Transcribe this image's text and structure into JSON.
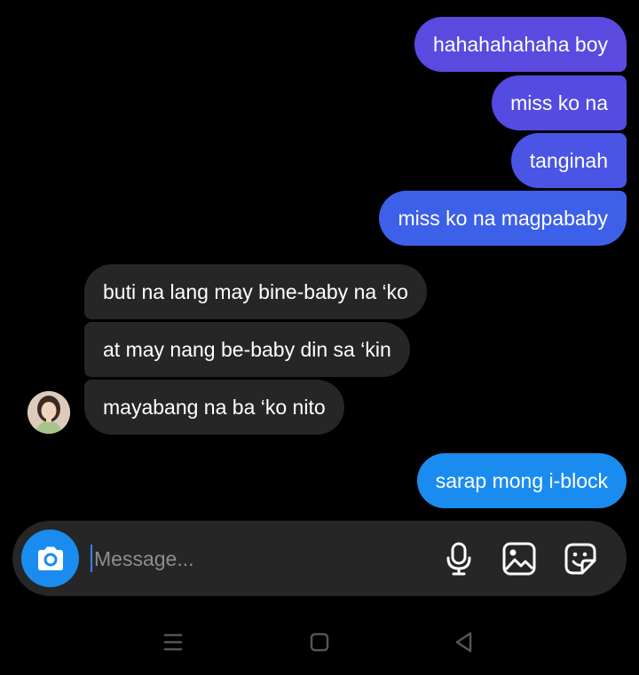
{
  "thread": {
    "sent_top": [
      "hahahahahaha boy",
      "miss ko na",
      "tanginah",
      "miss ko na magpababy"
    ],
    "received": [
      "buti na lang may bine-baby na ‘ko",
      "at may nang be-baby din sa ‘kin",
      "mayabang na ba ‘ko nito"
    ],
    "sent_bottom": [
      "sarap mong i-block"
    ]
  },
  "composer": {
    "placeholder": "Message..."
  },
  "colors": {
    "background": "#000000",
    "received_bubble": "#262626",
    "sent_gradient": [
      "#5b4ae0",
      "#1a8cf0"
    ],
    "camera_button": "#1a8cf0",
    "caret": "#3b82f6"
  },
  "icons": {
    "composer": [
      "camera-icon",
      "microphone-icon",
      "gallery-icon",
      "sticker-icon"
    ],
    "navigation": [
      "menu-nav-icon",
      "home-nav-icon",
      "back-nav-icon"
    ]
  }
}
